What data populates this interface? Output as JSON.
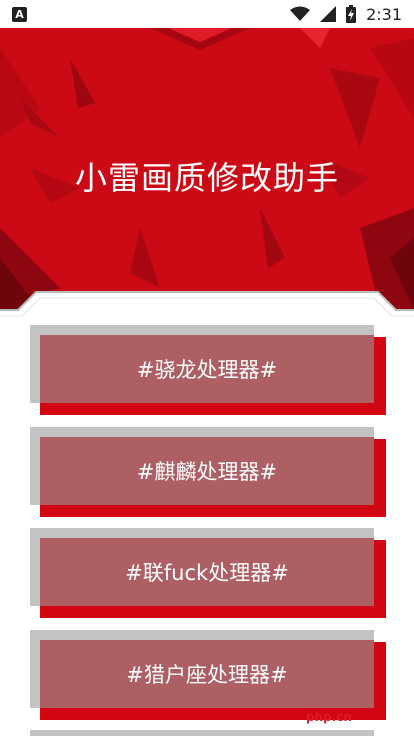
{
  "status_bar": {
    "notification_icon_text": "A",
    "time": "2:31",
    "icons": [
      "wifi-icon",
      "signal-icon",
      "battery-charging-icon"
    ]
  },
  "banner": {
    "title": "小雷画质修改助手",
    "color": "#cc0a16"
  },
  "options": [
    {
      "label": "#骁龙处理器#"
    },
    {
      "label": "#麒麟处理器#"
    },
    {
      "label": "#联fuck处理器#"
    },
    {
      "label": "#猎户座处理器#"
    }
  ],
  "watermark": "php.cn",
  "colors": {
    "card_face": "#ad5f64",
    "card_shadow_red": "#d10612",
    "card_shadow_gray": "#c3c3c3"
  }
}
